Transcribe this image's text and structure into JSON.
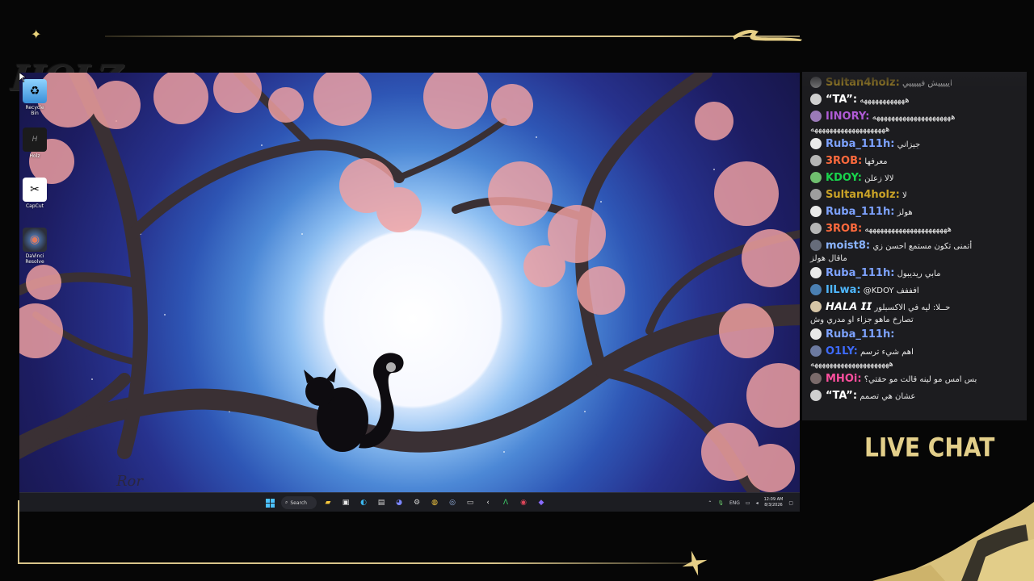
{
  "overlay": {
    "logo_text": "HOLZ",
    "live_chat_label": "LIVE CHAT",
    "accent": "#d8c48a"
  },
  "desktop": {
    "icons": [
      {
        "label": "Recycle Bin",
        "icon": "recycle-bin-icon"
      },
      {
        "label": "Holz",
        "icon": "holz-folder-icon"
      },
      {
        "label": "CapCut",
        "icon": "capcut-icon"
      },
      {
        "label": "DaVinci Resolve",
        "icon": "davinci-resolve-icon"
      }
    ],
    "signature": "Ror"
  },
  "taskbar": {
    "search_label": "Search",
    "language": "ENG",
    "time": "12:09 AM",
    "date": "8/3/2026"
  },
  "chat": {
    "messages": [
      {
        "user": "Sultan4holz:",
        "color": "#c9a227",
        "text": "ايييييش فيييييي"
      },
      {
        "user": "“TA”:",
        "color": "#ffffff",
        "text": "ههههههههههههه"
      },
      {
        "user": "IINORY:",
        "color": "#b05bd6",
        "text": "هههههههههههههههههههههه",
        "wrap": "ههههههههههههههههههههه"
      },
      {
        "user": "Ruba_111h:",
        "color": "#7da2ff",
        "text": "جيزاني"
      },
      {
        "user": "3ROB:",
        "color": "#ff6a3d",
        "text": "معرفها"
      },
      {
        "user": "KDOY:",
        "color": "#19d34c",
        "text": "لالا زعلن"
      },
      {
        "user": "Sultan4holz:",
        "color": "#c9a227",
        "text": "لا"
      },
      {
        "user": "Ruba_111h:",
        "color": "#7da2ff",
        "text": "هولز"
      },
      {
        "user": "3ROB:",
        "color": "#ff6a3d",
        "text": "ههههههههههههههههههههههه"
      },
      {
        "user": "moist8:",
        "color": "#8ab4ff",
        "text": "أتمنى تكون مستمع احسن زي",
        "wrap": "ماقال هولز"
      },
      {
        "user": "Ruba_111h:",
        "color": "#7da2ff",
        "text": "مابي ريديبول"
      },
      {
        "user": "IlLwa:",
        "color": "#4fb8ff",
        "text": "@KDOY افففف"
      },
      {
        "user": "𝙃𝘼𝙇𝘼 𝙄𝙄",
        "color": "#ffffff",
        "text": "حــلا: ليه في الاكسبلور",
        "wrap": "تصارخ ماهو جزاء او مدري وش"
      },
      {
        "user": "Ruba_111h:",
        "color": "#7da2ff",
        "text": ""
      },
      {
        "user": "O1LY:",
        "color": "#3e6bff",
        "text": "اهم شيء ترسم",
        "wrap": "هههههههههههههههههههههه"
      },
      {
        "user": "MHOi:",
        "color": "#ff4f9e",
        "text": "بس امس مو لينه قالت مو حقتي؟"
      },
      {
        "user": "“TA”:",
        "color": "#ffffff",
        "text": "عشان هي تصمم"
      }
    ]
  }
}
